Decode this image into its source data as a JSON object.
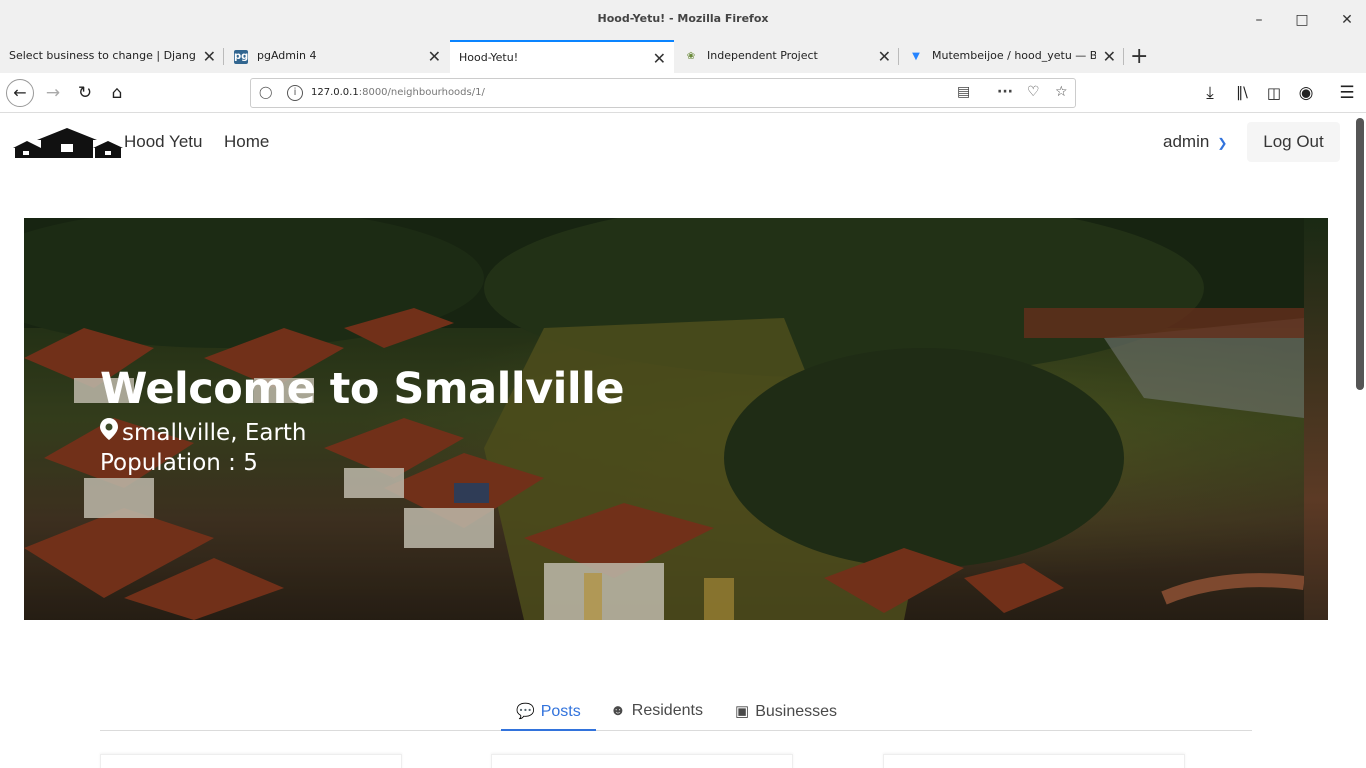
{
  "window": {
    "title": "Hood-Yetu! - Mozilla Firefox"
  },
  "tabs": [
    {
      "label": "Select business to change | Django",
      "icon": ""
    },
    {
      "label": "pgAdmin 4",
      "icon": "pgadmin-icon"
    },
    {
      "label": "Hood-Yetu!",
      "icon": ""
    },
    {
      "label": "Independent Project",
      "icon": "palm-tree-icon"
    },
    {
      "label": "Mutembeijoe / hood_yetu — Bi",
      "icon": "bitbucket-icon"
    }
  ],
  "address": {
    "host": "127.0.0.1",
    "rest": ":8000/neighbourhoods/1/"
  },
  "site": {
    "brand": "Hood Yetu",
    "home": "Home",
    "user": "admin",
    "logout": "Log Out"
  },
  "hero": {
    "title": "Welcome to Smallville",
    "location": "smallville, Earth",
    "population": "Population : 5"
  },
  "page_tabs": [
    {
      "label": "Posts",
      "icon": "comments-icon",
      "active": true
    },
    {
      "label": "Residents",
      "icon": "users-icon",
      "active": false
    },
    {
      "label": "Businesses",
      "icon": "briefcase-icon",
      "active": false
    }
  ],
  "colors": {
    "accent": "#3273dc",
    "firefox_tab_accent": "#0a84ff"
  }
}
